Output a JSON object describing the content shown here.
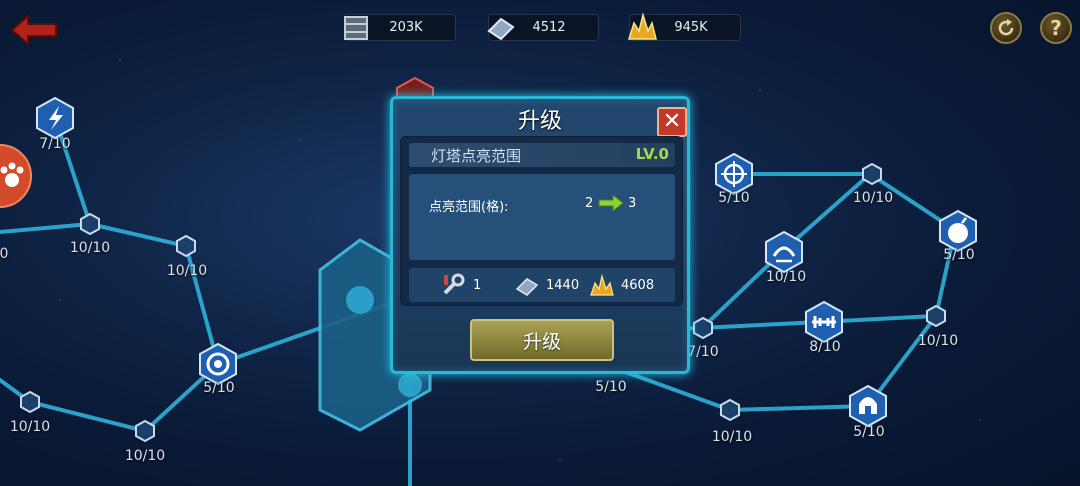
{
  "resources": [
    {
      "icon": "crate-icon",
      "value": "203K"
    },
    {
      "icon": "metal-ingot-icon",
      "value": "4512"
    },
    {
      "icon": "gold-crystal-icon",
      "value": "945K"
    }
  ],
  "map_labels": [
    "7/10",
    "10/10",
    "10/10",
    "5/10",
    "10/10",
    "10/10",
    "5/10",
    "10/10",
    "5/10",
    "10/10",
    "8/10",
    "10/10",
    "7/10",
    "5/10",
    "10/10",
    "5/10",
    "0"
  ],
  "dialog": {
    "title": "升级",
    "close_label": "✕",
    "item_name": "灯塔点亮范围",
    "level": "LV.0",
    "stat_label": "点亮范围(格):",
    "stat_from": "2",
    "stat_to": "3",
    "costs": [
      {
        "icon": "wrench-icon",
        "value": "1"
      },
      {
        "icon": "metal-ingot-icon",
        "value": "1440"
      },
      {
        "icon": "gold-crystal-icon",
        "value": "4608"
      }
    ],
    "button_label": "升级"
  },
  "colors": {
    "accent": "#2ab8d6",
    "level_green": "#a9d94a",
    "close_red": "#c2392b",
    "button_olive": "#8a843c"
  }
}
